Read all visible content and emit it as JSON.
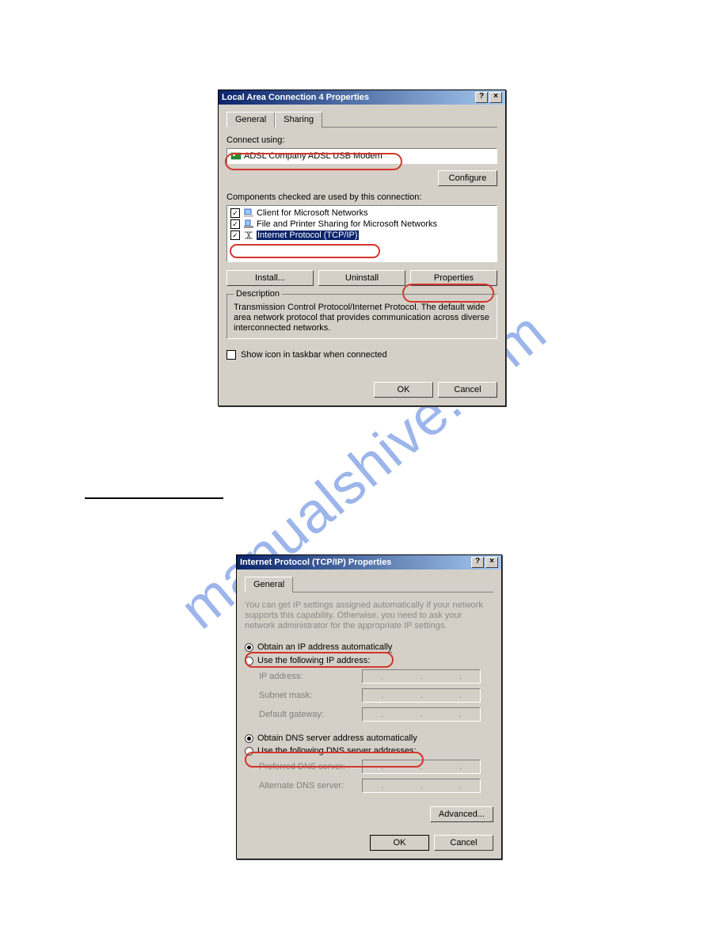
{
  "watermark": "manualshive.com",
  "dialog1": {
    "title": "Local Area Connection 4 Properties",
    "tabs": [
      "General",
      "Sharing"
    ],
    "connectUsingLabel": "Connect using:",
    "adapter": "ADSL Company ADSL USB Modem",
    "configureBtn": "Configure",
    "componentsLabel": "Components checked are used by this connection:",
    "components": [
      {
        "checked": true,
        "label": "Client for Microsoft Networks"
      },
      {
        "checked": true,
        "label": "File and Printer Sharing for Microsoft Networks"
      },
      {
        "checked": true,
        "label": "Internet Protocol (TCP/IP)",
        "selected": true
      }
    ],
    "installBtn": "Install...",
    "uninstallBtn": "Uninstall",
    "propertiesBtn": "Properties",
    "descLegend": "Description",
    "descText": "Transmission Control Protocol/Internet Protocol. The default wide area network protocol that provides communication across diverse interconnected networks.",
    "showIcon": "Show icon in taskbar when connected",
    "okBtn": "OK",
    "cancelBtn": "Cancel"
  },
  "dialog2": {
    "title": "Internet Protocol (TCP/IP) Properties",
    "tabs": [
      "General"
    ],
    "introText": "You can get IP settings assigned automatically if your network supports this capability. Otherwise, you need to ask your network administrator for the appropriate IP settings.",
    "radioObtainIP": "Obtain an IP address automatically",
    "radioUseIP": "Use the following IP address:",
    "ipAddressLbl": "IP address:",
    "subnetLbl": "Subnet mask:",
    "gatewayLbl": "Default gateway:",
    "radioObtainDNS": "Obtain DNS server address automatically",
    "radioUseDNS": "Use the following DNS server addresses:",
    "prefDnsLbl": "Preferred DNS server:",
    "altDnsLbl": "Alternate DNS server:",
    "advancedBtn": "Advanced...",
    "okBtn": "OK",
    "cancelBtn": "Cancel"
  }
}
